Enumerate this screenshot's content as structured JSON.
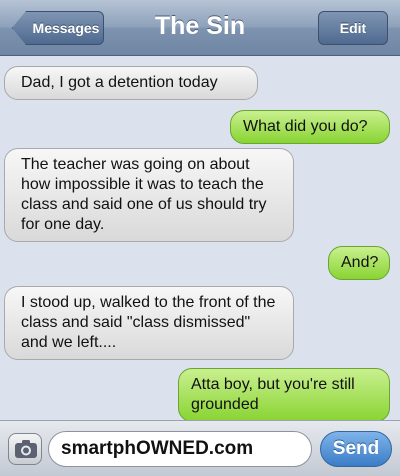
{
  "header": {
    "back_label": "Messages",
    "title": "The Sin",
    "edit_label": "Edit"
  },
  "messages": [
    {
      "side": "in",
      "text": "Dad, I got a detention today"
    },
    {
      "side": "out",
      "text": "What did you do?"
    },
    {
      "side": "in",
      "text": "The teacher was going on about how impossible it was to teach the class and said one of us should try for one day."
    },
    {
      "side": "out",
      "text": "And?"
    },
    {
      "side": "in",
      "text": "I stood up, walked to the front of the class and said \"class dismissed\" and we left...."
    },
    {
      "side": "out",
      "text": "Atta boy, but you're still grounded"
    }
  ],
  "input": {
    "value": "smartphOWNED.com",
    "send_label": "Send",
    "camera_icon": "camera-icon"
  },
  "colors": {
    "incoming_bubble": "#e9e9e9",
    "outgoing_bubble": "#a6e05a",
    "background": "#dbe2ed"
  }
}
